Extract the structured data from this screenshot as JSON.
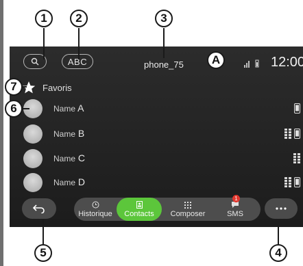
{
  "header": {
    "abc_label": "ABC",
    "phone_name": "phone_75",
    "time": "12:00"
  },
  "favorites": {
    "label": "Favoris"
  },
  "contacts": [
    {
      "prefix": "Name",
      "letter": "A",
      "icons": [
        "phone-icon"
      ]
    },
    {
      "prefix": "Name",
      "letter": "B",
      "icons": [
        "keypad-icon",
        "phone-icon"
      ]
    },
    {
      "prefix": "Name",
      "letter": "C",
      "icons": [
        "keypad-icon"
      ]
    },
    {
      "prefix": "Name",
      "letter": "D",
      "icons": [
        "keypad-icon",
        "phone-icon"
      ]
    }
  ],
  "tabs": [
    {
      "label": "Historique",
      "icon": "clock-icon",
      "active": false
    },
    {
      "label": "Contacts",
      "icon": "contacts-icon",
      "active": true
    },
    {
      "label": "Composer",
      "icon": "keypad-icon",
      "active": false
    },
    {
      "label": "SMS",
      "icon": "chat-icon",
      "active": false
    }
  ],
  "sms_badge": "1",
  "callouts": {
    "c1": "1",
    "c2": "2",
    "c3": "3",
    "cA": "A",
    "c4": "4",
    "c5": "5",
    "c6": "6",
    "c7": "7"
  },
  "colors": {
    "active_tab": "#5cc63b",
    "badge": "#e2382f",
    "screen_bg": "#242424"
  }
}
